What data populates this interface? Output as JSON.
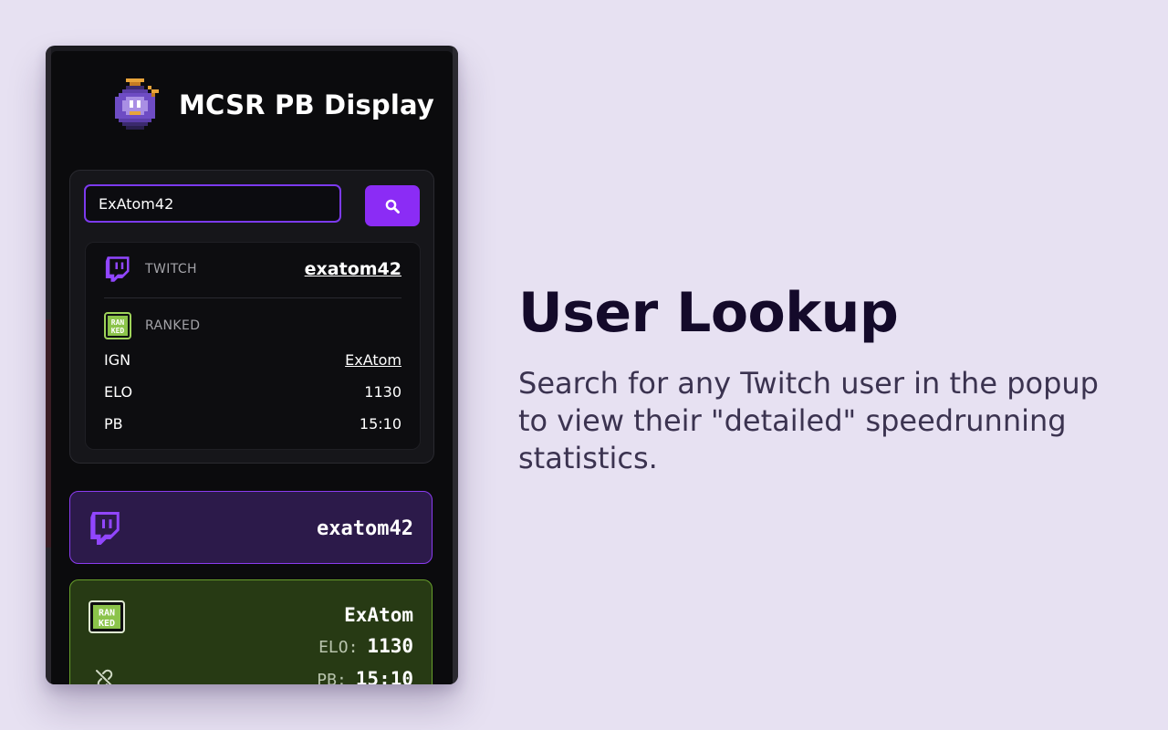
{
  "app": {
    "title": "MCSR PB Display"
  },
  "search": {
    "value": "ExAtom42",
    "placeholder": ""
  },
  "result": {
    "twitch_label": "TWITCH",
    "twitch_user": "exatom42",
    "ranked_label": "RANKED",
    "ranked_badge_text": "RAN KED",
    "stats": [
      {
        "label": "IGN",
        "value": "ExAtom"
      },
      {
        "label": "ELO",
        "value": "1130"
      },
      {
        "label": "PB",
        "value": "15:10"
      }
    ]
  },
  "twitch_card": {
    "username": "exatom42"
  },
  "ranked_card": {
    "ign": "ExAtom",
    "elo_label": "ELO:",
    "elo_value": "1130",
    "pb_label": "PB:",
    "pb_value": "15:10"
  },
  "feature": {
    "headline": "User Lookup",
    "description": "Search for any Twitch user in the popup to view their \"detailed\" speedrunning statistics."
  },
  "colors": {
    "accent_purple": "#8b2cf5",
    "twitch_purple": "#9146ff",
    "ranked_green": "#68a02c",
    "page_background": "#e7e1f2"
  },
  "icons": [
    "clock-logo-icon",
    "search-icon",
    "twitch-icon",
    "ranked-icon",
    "unlink-icon"
  ]
}
